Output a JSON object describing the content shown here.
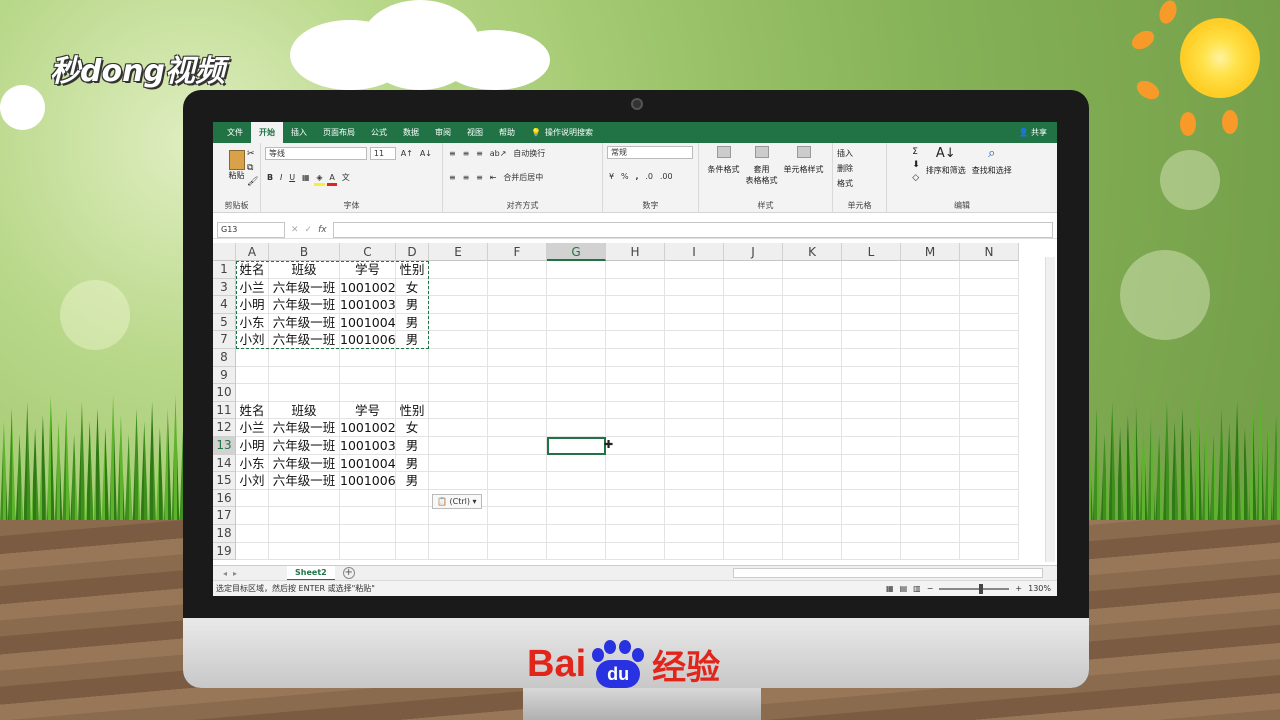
{
  "watermark": {
    "brand": "秒dong视频",
    "footer_left": "Bai",
    "footer_paw": "du",
    "footer_right": "经验"
  },
  "ribbon": {
    "tabs": [
      "文件",
      "开始",
      "插入",
      "页面布局",
      "公式",
      "数据",
      "审阅",
      "视图",
      "帮助"
    ],
    "active_tab": "开始",
    "search_label": "操作说明搜索",
    "share_label": "共享",
    "clipboard": {
      "paste_label": "粘贴",
      "group_label": "剪贴板"
    },
    "font": {
      "font_name": "等线",
      "font_size": "11",
      "bold": "B",
      "italic": "I",
      "underline": "U",
      "group_label": "字体"
    },
    "alignment": {
      "wrap_label": "自动换行",
      "merge_label": "合并后居中",
      "group_label": "对齐方式"
    },
    "number": {
      "format": "常规",
      "percent": "%",
      "comma": ",",
      "group_label": "数字"
    },
    "styles": {
      "conditional": "条件格式",
      "table_format_1": "套用",
      "table_format_2": "表格格式",
      "cell_styles": "单元格样式",
      "group_label": "样式"
    },
    "cells": {
      "insert": "插入",
      "delete": "删除",
      "format": "格式",
      "group_label": "单元格"
    },
    "editing": {
      "sort": "排序和筛选",
      "find": "查找和选择",
      "group_label": "编辑"
    }
  },
  "formula_bar": {
    "name_box": "G13",
    "fx": "fx"
  },
  "columns": [
    "A",
    "B",
    "C",
    "D",
    "E",
    "F",
    "G",
    "H",
    "I",
    "J",
    "K",
    "L",
    "M",
    "N"
  ],
  "rows": [
    {
      "num": "1",
      "cells": [
        "姓名",
        "班级",
        "学号",
        "性别"
      ],
      "header": true
    },
    {
      "num": "3",
      "cells": [
        "小兰",
        "六年级一班",
        "1001002",
        "女"
      ]
    },
    {
      "num": "4",
      "cells": [
        "小明",
        "六年级一班",
        "1001003",
        "男"
      ]
    },
    {
      "num": "5",
      "cells": [
        "小东",
        "六年级一班",
        "1001004",
        "男"
      ]
    },
    {
      "num": "7",
      "cells": [
        "小刘",
        "六年级一班",
        "1001006",
        "男"
      ]
    },
    {
      "num": "8",
      "cells": [
        "",
        "",
        "",
        ""
      ]
    },
    {
      "num": "9",
      "cells": [
        "",
        "",
        "",
        ""
      ]
    },
    {
      "num": "10",
      "cells": [
        "",
        "",
        "",
        ""
      ]
    },
    {
      "num": "11",
      "cells": [
        "姓名",
        "班级",
        "学号",
        "性别"
      ],
      "header": true
    },
    {
      "num": "12",
      "cells": [
        "小兰",
        "六年级一班",
        "1001002",
        "女"
      ]
    },
    {
      "num": "13",
      "cells": [
        "小明",
        "六年级一班",
        "1001003",
        "男"
      ]
    },
    {
      "num": "14",
      "cells": [
        "小东",
        "六年级一班",
        "1001004",
        "男"
      ]
    },
    {
      "num": "15",
      "cells": [
        "小刘",
        "六年级一班",
        "1001006",
        "男"
      ]
    },
    {
      "num": "16",
      "cells": [
        "",
        "",
        "",
        ""
      ]
    },
    {
      "num": "17",
      "cells": [
        "",
        "",
        "",
        ""
      ]
    },
    {
      "num": "18",
      "cells": [
        "",
        "",
        "",
        ""
      ]
    },
    {
      "num": "19",
      "cells": [
        "",
        "",
        "",
        ""
      ]
    }
  ],
  "selected_column": "G",
  "selected_row": "13",
  "paste_options": "(Ctrl)",
  "sheet_tab": "Sheet2",
  "status_text": "选定目标区域，然后按 ENTER 或选择\"粘贴\"",
  "zoom": "130%",
  "colors": {
    "excel_green": "#217346",
    "accent_red": "#e1251b",
    "baidu_blue": "#2932e1"
  }
}
